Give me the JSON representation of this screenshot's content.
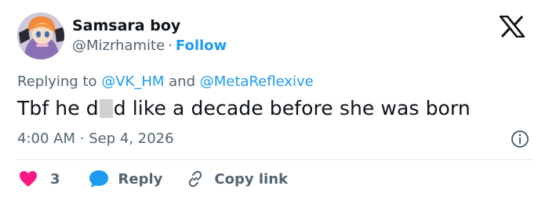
{
  "author": {
    "name": "Samsara boy",
    "handle": "@Mizrhamite",
    "separator": "·",
    "follow_label": "Follow"
  },
  "reply_context": {
    "prefix": "Replying to",
    "mentions": [
      "@VK_HM",
      "@MetaReflexive"
    ],
    "joiner": "and"
  },
  "tweet": {
    "text_before": "Tbf he d",
    "text_after": "d like a decade before she was born"
  },
  "meta": {
    "time": "4:00 AM",
    "separator": "·",
    "date": "Sep 4, 2026"
  },
  "actions": {
    "like_count": "3",
    "reply_label": "Reply",
    "copy_label": "Copy link"
  },
  "colors": {
    "accent": "#1d9bf0",
    "like": "#f91880",
    "text": "#0f1419",
    "muted": "#536471"
  },
  "icons": [
    "x-logo-icon",
    "info-icon",
    "heart-icon",
    "reply-bubble-icon",
    "link-icon"
  ]
}
